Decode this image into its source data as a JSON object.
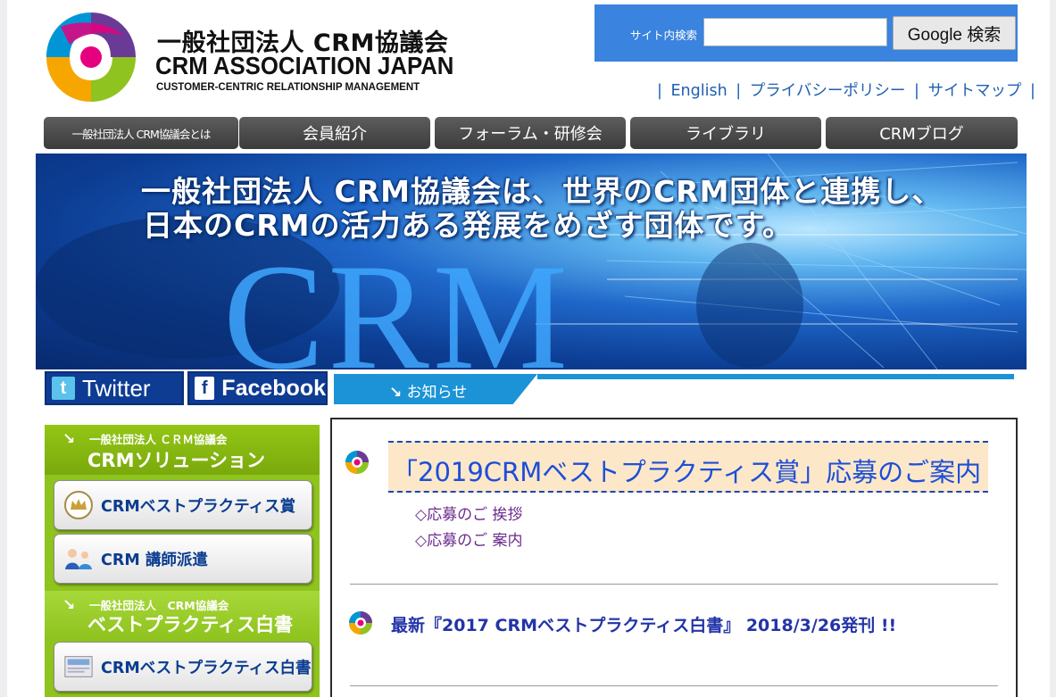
{
  "header": {
    "org_title_ja": "一般社団法人 CRM協議会",
    "org_title_en": "CRM ASSOCIATION JAPAN",
    "org_subtitle": "CUSTOMER-CENTRIC RELATIONSHIP MANAGEMENT",
    "logo_colors": [
      "#e6007e",
      "#f7a600",
      "#0096d6",
      "#8fc31f",
      "#6a3b96"
    ]
  },
  "search": {
    "label": "サイト内検索",
    "value": "",
    "button_label": "Google 検索"
  },
  "util_links": {
    "separator": "|",
    "items": [
      "English",
      "プライバシーポリシー",
      "サイトマップ"
    ]
  },
  "nav": {
    "items": [
      {
        "label": "一般社団法人 CRM協議会とは"
      },
      {
        "label": "会員紹介"
      },
      {
        "label": "フォーラム・研修会"
      },
      {
        "label": "ライブラリ"
      },
      {
        "label": "CRMブログ"
      }
    ]
  },
  "banner": {
    "line1": "一般社団法人 CRM協議会は、世界のCRM団体と連携し、",
    "line2": "日本のCRMの活力ある発展をめざす団体です。",
    "big_text": "CRM"
  },
  "social": {
    "twitter_label": "Twitter",
    "facebook_label": "Facebook"
  },
  "notice": {
    "label": "お知らせ",
    "accent": "#1b93d6"
  },
  "sidebar": {
    "section1": {
      "sub": "一般社団法人 ＣＲＭ協議会",
      "main": "CRMソリューション",
      "buttons": [
        {
          "label": "CRMベストプラクティス賞",
          "icon": "crown-icon"
        },
        {
          "label": "CRM 講師派遣",
          "icon": "speaker-icon"
        }
      ]
    },
    "section2": {
      "sub": "一般社団法人　CRM協議会",
      "main": "ベストプラクティス白書",
      "buttons": [
        {
          "label": "CRMベストプラクティス白書",
          "icon": "book-icon"
        }
      ]
    },
    "accent": "#8fc31e"
  },
  "content": {
    "headline": "「2019CRMベストプラクティス賞」応募のご案内",
    "sub_links": [
      "◇応募のご 挨拶",
      "◇応募のご 案内"
    ],
    "news_item": "最新『2017 CRMベストプラクティス白書』 2018/3/26発刊 !!"
  }
}
